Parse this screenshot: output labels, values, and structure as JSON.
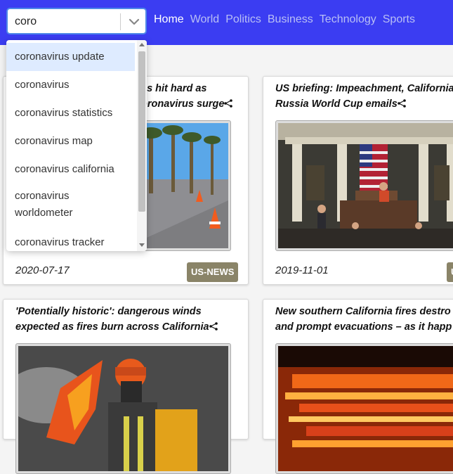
{
  "search": {
    "value": "coro",
    "placeholder": ""
  },
  "nav": {
    "links": [
      "Home",
      "World",
      "Politics",
      "Business",
      "Technology",
      "Sports"
    ]
  },
  "colors": {
    "navbar": "#3b3df2",
    "tag": "#8a8468",
    "highlight": "#deebff"
  },
  "dropdown": {
    "options": [
      "coronavirus update",
      "coronavirus",
      "coronavirus statistics",
      "coronavirus map",
      "coronavirus california",
      "coronavirus worldometer",
      "coronavirus tracker"
    ]
  },
  "articles": [
    {
      "title": "es hit hard as",
      "title2": "oronavirus surge",
      "date": "2020-07-17",
      "tag": "US-NEWS",
      "image": "outdoor-testing-site"
    },
    {
      "title": "US briefing: Impeachment, California",
      "title2": "Russia World Cup emails",
      "date": "2019-11-01",
      "tag": "U",
      "image": "house-chamber"
    },
    {
      "title": "'Potentially historic': dangerous winds",
      "title2": "expected as fires burn across California",
      "date": "",
      "tag": "",
      "image": "firefighter"
    },
    {
      "title": "New southern California fires destro",
      "title2": "and prompt evacuations – as it happ",
      "date": "",
      "tag": "",
      "image": "fire-blaze"
    }
  ]
}
